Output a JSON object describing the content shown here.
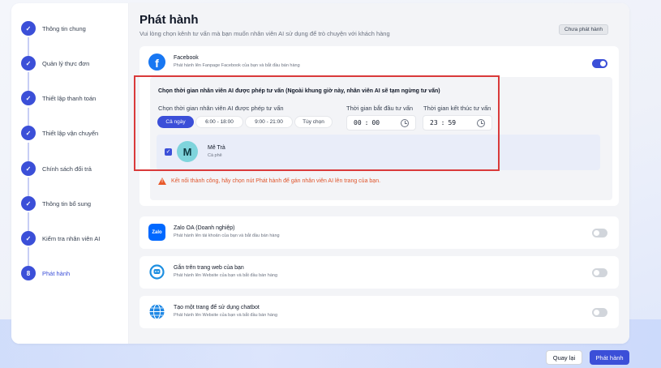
{
  "sidebar": {
    "steps": [
      {
        "label": "Thông tin chung",
        "number": "1",
        "done": true
      },
      {
        "label": "Quản lý thực đơn",
        "number": "2",
        "done": true
      },
      {
        "label": "Thiết lập thanh toán",
        "number": "3",
        "done": true
      },
      {
        "label": "Thiết lập vận chuyển",
        "number": "4",
        "done": true
      },
      {
        "label": "Chính sách đổi trả",
        "number": "5",
        "done": true
      },
      {
        "label": "Thông tin bổ sung",
        "number": "6",
        "done": true
      },
      {
        "label": "Kiểm tra nhân viên AI",
        "number": "7",
        "done": true
      },
      {
        "label": "Phát hành",
        "number": "8",
        "done": false
      }
    ],
    "check_glyph": "✓"
  },
  "header": {
    "title": "Phát hành",
    "subtitle": "Vui lòng chọn kênh tư vấn mà bạn muốn nhân viên AI sử dụng để trò chuyện với khách hàng",
    "unpublish_label": "Chưa phát hành"
  },
  "channels": {
    "facebook": {
      "title": "Facebook",
      "desc": "Phát hành lên Fanpage Facebook của bạn và bắt đầu bán hàng",
      "enabled": true,
      "icon": "facebook-icon",
      "icon_letter": "f",
      "color": "#1877f2"
    },
    "zalo": {
      "title": "Zalo OA (Doanh nghiệp)",
      "desc": "Phát hành lên tài khoản của bạn và bắt đầu bán hàng",
      "enabled": false,
      "icon": "zalo-icon",
      "icon_text": "Zalo",
      "color": "#0068ff"
    },
    "web": {
      "title": "Gắn trên trang web của bạn",
      "desc": "Phát hành lên Website của bạn và bắt đầu bán hàng",
      "enabled": false,
      "icon": "chat-bubble-icon"
    },
    "page": {
      "title": "Tạo một trang để sử dụng chatbot",
      "desc": "Phát hành lên Website của bạn và bắt đầu bán hàng",
      "enabled": false,
      "icon": "globe-icon"
    }
  },
  "schedule": {
    "heading": "Chọn thời gian nhân viên AI được phép tư vấn (Ngoài khung giờ này, nhân viên AI sẽ tạm ngừng tư vấn)",
    "allowed_label": "Chọn thời gian nhân viên AI được phép tư vấn",
    "options": [
      "Cả ngày",
      "6:00 - 18:00",
      "9:00 - 21:00",
      "Tùy chọn"
    ],
    "selected": "Cả ngày",
    "start_label": "Thời gian bắt đầu tư vấn",
    "start_hour": "00",
    "start_min": "00",
    "end_label": "Thời gian kết thúc tư vấn",
    "end_hour": "23",
    "end_min": "59"
  },
  "agent": {
    "name": "Mê Trà",
    "role": "Cà phê",
    "initial": "M",
    "checked": true
  },
  "warning": {
    "text": "Kết nối thành công, hãy chọn nút Phát hành để gán nhân viên AI lên trang của bạn.",
    "glyph": "!"
  },
  "footer": {
    "back_label": "Quay lại",
    "publish_label": "Phát hành"
  },
  "colors": {
    "accent": "#3b4fd8",
    "warning": "#e0542a",
    "highlight": "#d93a3a"
  }
}
